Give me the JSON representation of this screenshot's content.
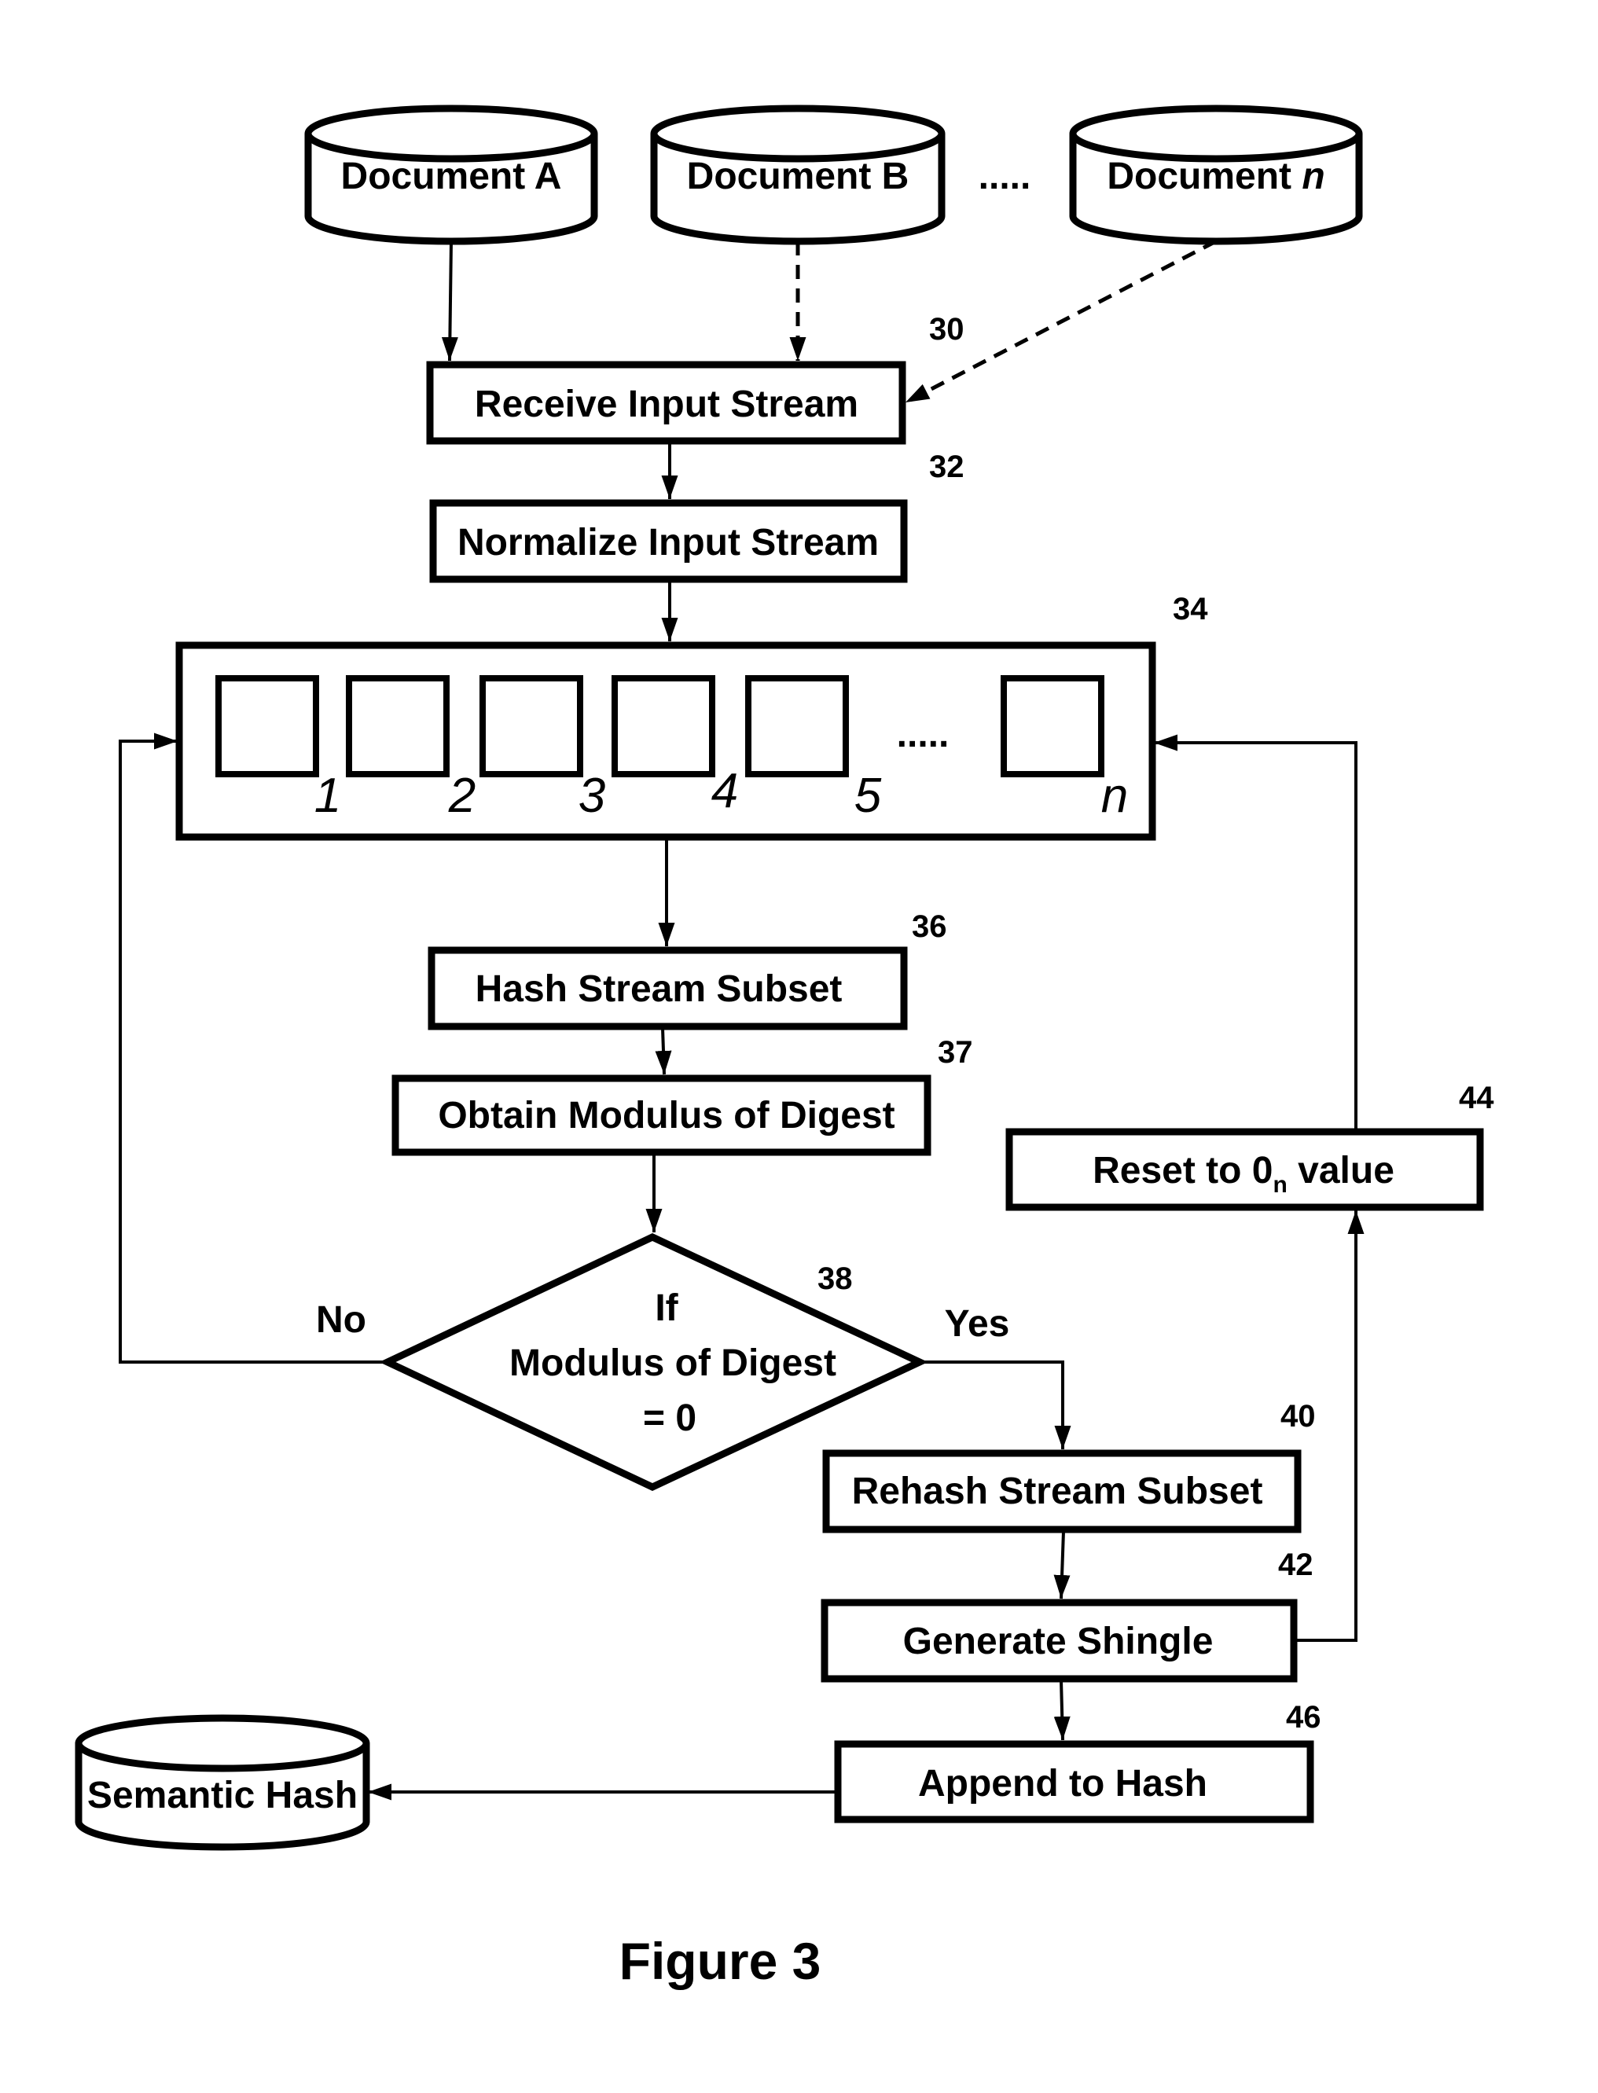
{
  "sources": [
    {
      "label": "Document A",
      "suffix": ""
    },
    {
      "label": "Document ",
      "suffix": "B"
    },
    {
      "label": "Document ",
      "suffix": "n"
    }
  ],
  "source_ellipsis": ".....",
  "steps": {
    "receive": {
      "label": "Receive Input Stream",
      "ref": "30"
    },
    "normalize": {
      "label": "Normalize Input Stream",
      "ref": "32"
    },
    "buffer": {
      "ref": "34",
      "cells": [
        "1",
        "2",
        "3",
        "4",
        "5",
        "n"
      ],
      "ellipsis": "....."
    },
    "hash": {
      "label": "Hash Stream Subset",
      "ref": "36"
    },
    "modulus": {
      "label": "Obtain Modulus of Digest",
      "ref": "37"
    },
    "decision": {
      "lines": [
        "If",
        "Modulus of Digest",
        "= 0"
      ],
      "ref": "38",
      "no_label": "No",
      "yes_label": "Yes"
    },
    "rehash": {
      "label": "Rehash Stream Subset",
      "ref": "40"
    },
    "shingle": {
      "label": "Generate Shingle",
      "ref": "42"
    },
    "reset": {
      "label_prefix": "Reset to 0",
      "label_sub": "n",
      "label_suffix": " value",
      "ref": "44"
    },
    "append": {
      "label": "Append to Hash",
      "ref": "46"
    }
  },
  "output": {
    "label": "Semantic Hash"
  },
  "figure_title": "Figure 3"
}
